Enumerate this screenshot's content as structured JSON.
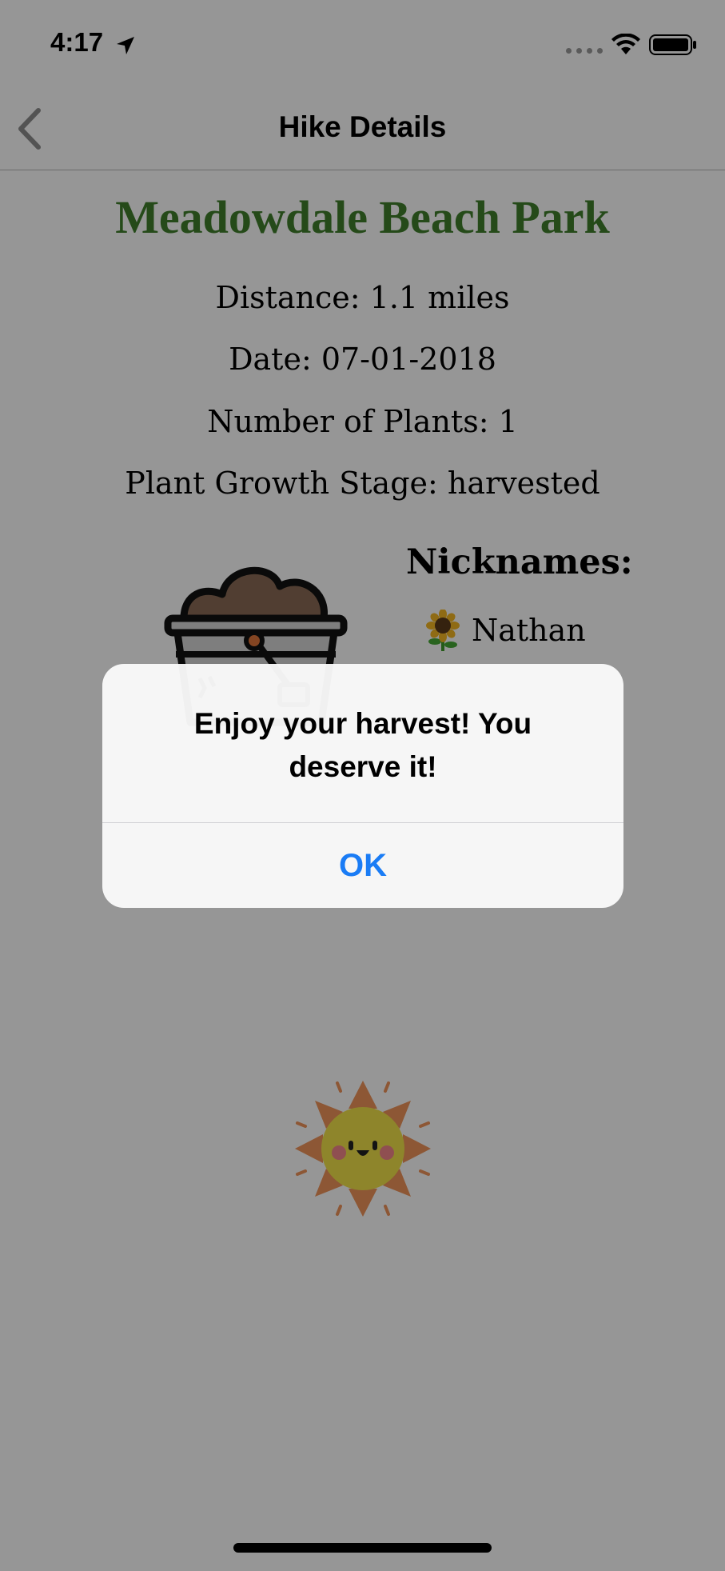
{
  "status_bar": {
    "time": "4:17",
    "location_icon": "location-arrow-icon",
    "signal_icon": "signal-dots-icon",
    "wifi_icon": "wifi-icon",
    "battery_icon": "battery-icon"
  },
  "nav": {
    "back_icon": "chevron-left-icon",
    "title": "Hike Details"
  },
  "hike": {
    "name": "Meadowdale Beach Park",
    "distance": "Distance: 1.1 miles",
    "date": "Date: 07-01-2018",
    "plants": "Number of Plants: 1",
    "stage": "Plant Growth Stage: harvested"
  },
  "nicknames": {
    "heading": "Nicknames:",
    "items": [
      {
        "icon": "sunflower-icon",
        "name": "Nathan"
      }
    ]
  },
  "illustrations": {
    "bucket": "harvest-bucket-icon",
    "sun": "sun-face-icon"
  },
  "alert": {
    "message": "Enjoy your harvest! You deserve it!",
    "ok_label": "OK"
  },
  "colors": {
    "title_green": "#3f7f2b",
    "ios_blue": "#1a7cf5",
    "dim_overlay": "rgba(0,0,0,0.41)"
  }
}
